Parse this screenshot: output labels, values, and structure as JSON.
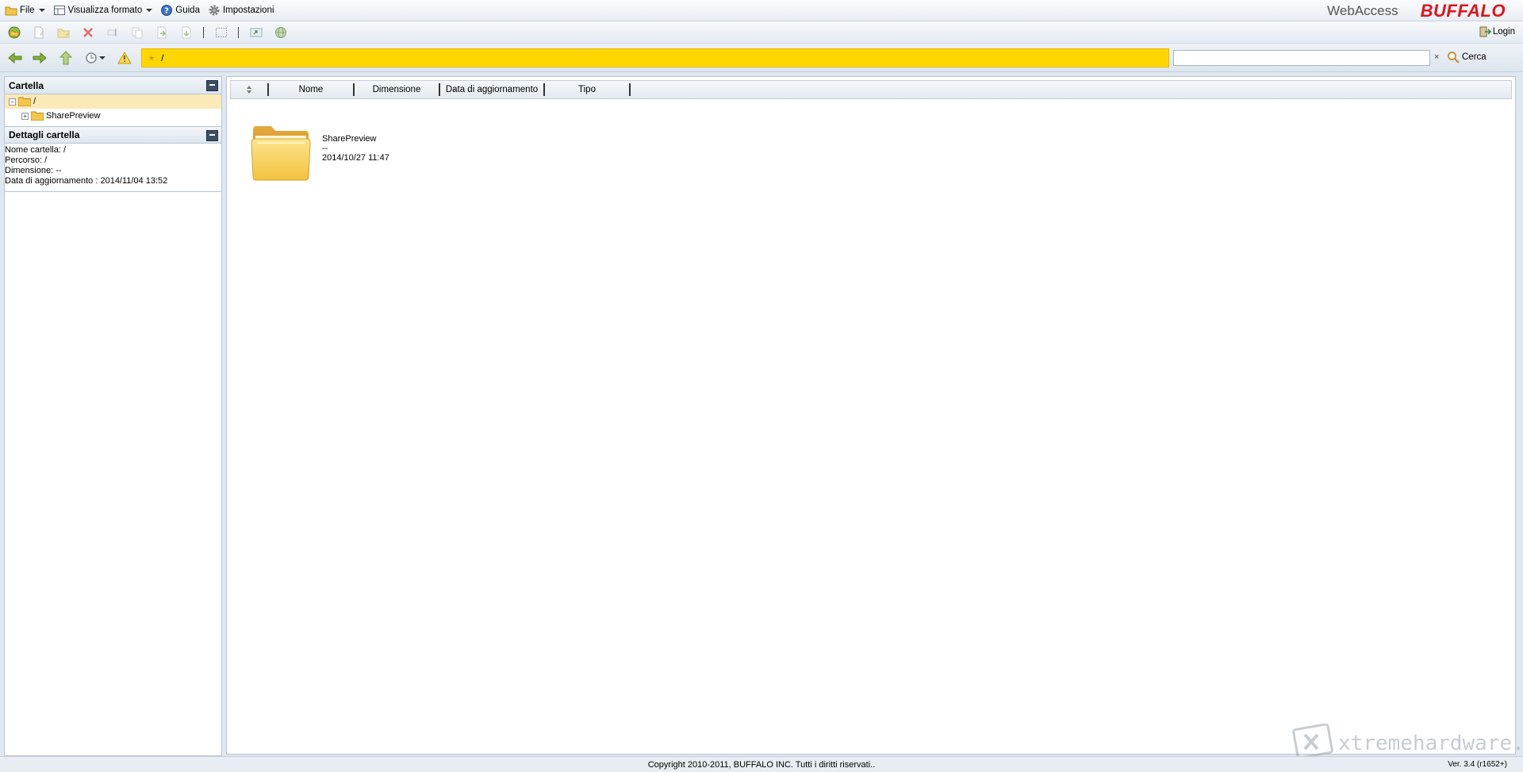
{
  "menubar": {
    "file": "File",
    "view_format": "Visualizza formato",
    "help": "Guida",
    "settings": "Impostazioni"
  },
  "brand": {
    "webaccess": "WebAccess",
    "logo": "BUFFALO"
  },
  "toolbar": {
    "login": "Login"
  },
  "address": {
    "path": "/",
    "search_placeholder": "",
    "search_clear": "×",
    "search_label": "Cerca"
  },
  "folder_panel": {
    "title": "Cartella",
    "tree": [
      {
        "label": "/",
        "selected": true
      },
      {
        "label": "SharePreview",
        "selected": false
      }
    ]
  },
  "details_panel": {
    "title": "Dettagli cartella",
    "lines": [
      "Nome cartella: /",
      "Percorso: /",
      "Dimensione: --",
      "Data di aggiornamento : 2014/11/04 13:52"
    ]
  },
  "columns": {
    "name": "Nome",
    "size": "Dimensione",
    "updated": "Data di aggiornamento",
    "type": "Tipo"
  },
  "files": [
    {
      "name": "SharePreview",
      "size": "--",
      "updated": "2014/10/27 11:47"
    }
  ],
  "footer": {
    "copyright": "Copyright 2010-2011, BUFFALO INC. Tutti i diritti riservati..",
    "version": "Ver. 3.4 (r1652+)"
  },
  "watermark": "xtremehardware.com",
  "colors": {
    "path_bar": "#ffd700",
    "brand_red": "#e0141c",
    "selected_row": "#fbe9b7"
  }
}
